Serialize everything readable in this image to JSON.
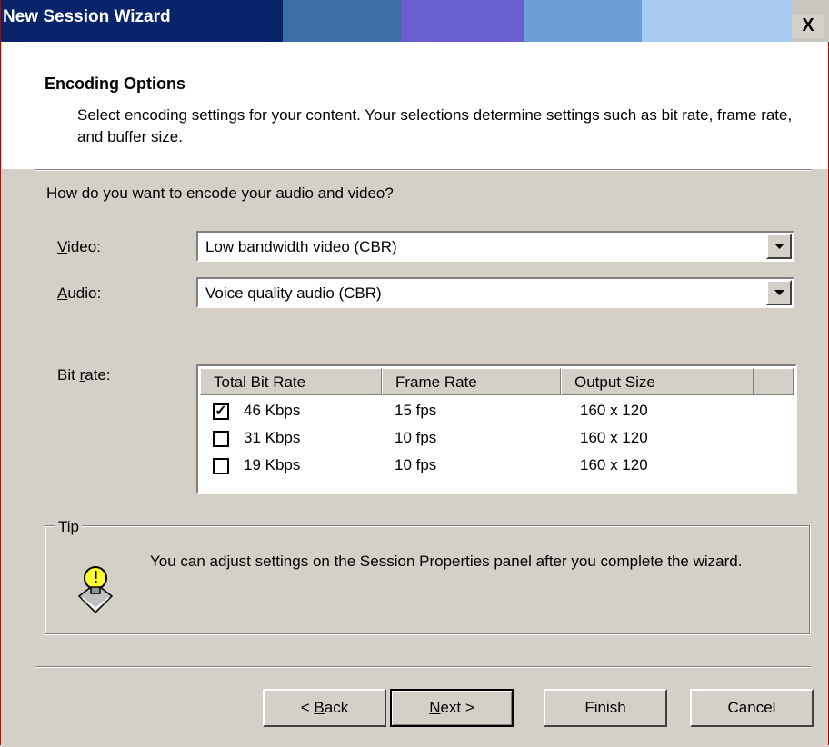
{
  "window": {
    "title": "New Session Wizard",
    "close_label": "X"
  },
  "header": {
    "title": "Encoding Options",
    "description": "Select encoding settings for your content. Your selections determine settings such as bit rate, frame rate, and buffer size."
  },
  "question": "How do you want to encode your audio and video?",
  "video": {
    "label_mnemonic": "V",
    "label_rest": "ideo:",
    "value": "Low bandwidth video (CBR)"
  },
  "audio": {
    "label_mnemonic": "A",
    "label_rest": "udio:",
    "value": "Voice quality audio (CBR)"
  },
  "bitrate": {
    "label_pre": "Bit ",
    "label_mnemonic": "r",
    "label_rest": "ate:",
    "columns": [
      "Total Bit Rate",
      "Frame Rate",
      "Output Size"
    ],
    "rows": [
      {
        "checked": true,
        "bitrate": "46 Kbps",
        "frame_rate": "15 fps",
        "output_size": "160 x 120"
      },
      {
        "checked": false,
        "bitrate": "31 Kbps",
        "frame_rate": "10 fps",
        "output_size": "160 x 120"
      },
      {
        "checked": false,
        "bitrate": "19 Kbps",
        "frame_rate": "10 fps",
        "output_size": "160 x 120"
      }
    ]
  },
  "tip": {
    "legend": "Tip",
    "icon": "lightbulb-icon",
    "text": "You can adjust settings on the Session Properties panel after you complete the wizard."
  },
  "buttons": {
    "back_pre": "< ",
    "back_mnemonic": "B",
    "back_rest": "ack",
    "next_mnemonic": "N",
    "next_rest": "ext >",
    "finish": "Finish",
    "cancel": "Cancel"
  }
}
